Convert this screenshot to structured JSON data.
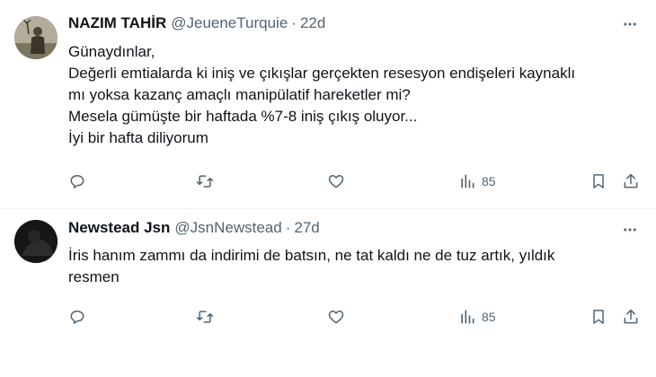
{
  "tweets": [
    {
      "name": "NAZIM TAHİR",
      "handle": "@JeueneTurquie",
      "separator": "·",
      "time": "22d",
      "lines": [
        "Günaydınlar,",
        "Değerli emtialarda ki iniş ve çıkışlar gerçekten resesyon endişeleri kaynaklı",
        "mı yoksa kazanç amaçlı manipülatif hareketler mi?",
        "Mesela gümüşte bir haftada %7-8 iniş çıkış oluyor...",
        "İyi bir hafta diliyorum"
      ],
      "views": "85"
    },
    {
      "name": "Newstead Jsn",
      "handle": "@JsnNewstead",
      "separator": "·",
      "time": "27d",
      "lines": [
        "İris hanım zammı da indirimi de batsın, ne tat kaldı ne de tuz artık, yıldık",
        "resmen"
      ],
      "views": "85"
    }
  ],
  "icons": {
    "more": "more-horizontal-icon",
    "reply": "reply-icon",
    "retweet": "retweet-icon",
    "like": "heart-icon",
    "views": "views-chart-icon",
    "bookmark": "bookmark-icon",
    "share": "share-icon"
  },
  "colors": {
    "text": "#0f1419",
    "secondary": "#536471",
    "divider": "#eff3f4"
  }
}
